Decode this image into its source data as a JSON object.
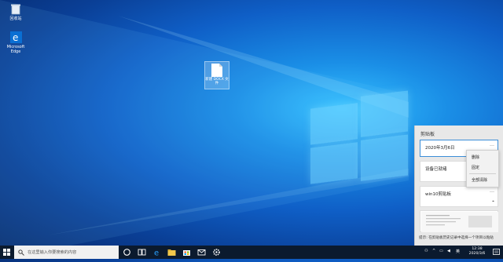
{
  "desktop": {
    "icons": [
      {
        "label": "回收站"
      },
      {
        "label": "Microsoft Edge"
      }
    ],
    "selected_file": {
      "label": "新建 DOCX 文件"
    }
  },
  "clipboard": {
    "title": "剪贴板",
    "items": [
      {
        "text": "2020年3月6日"
      },
      {
        "text": "设备已就绪"
      },
      {
        "text": "win10剪贴板"
      },
      {
        "text": ""
      }
    ],
    "hint": "提示: 在剪贴板历史记录中选择一个项目以粘贴",
    "context_menu": {
      "delete": "删除",
      "pin": "固定",
      "clear_all": "全部清除"
    }
  },
  "taskbar": {
    "search_placeholder": "在这里输入你要搜索的内容",
    "ime": "英",
    "time": "12:38",
    "date": "2020/3/6"
  },
  "colors": {
    "accent": "#0078d7",
    "taskbar": "#0b1a2e"
  }
}
